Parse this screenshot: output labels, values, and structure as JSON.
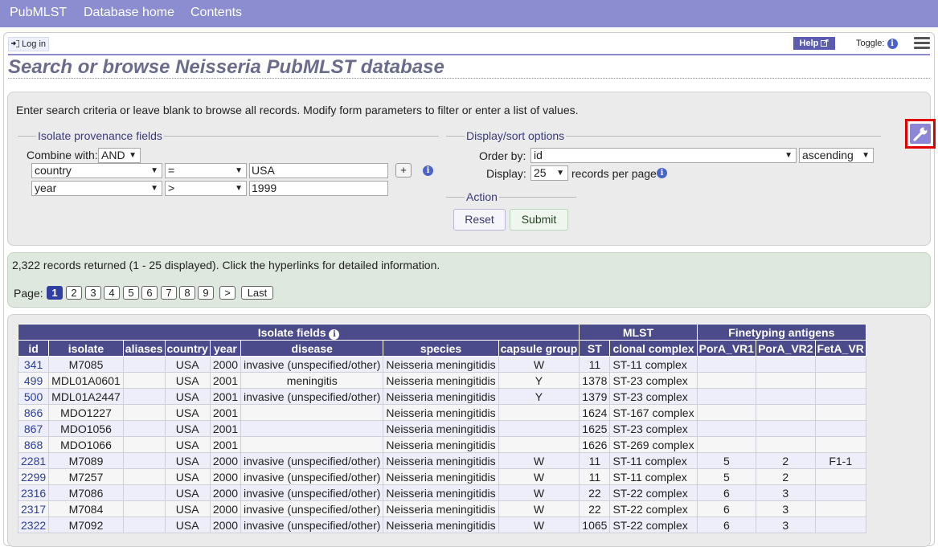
{
  "nav": {
    "items": [
      "PubMLST",
      "Database home",
      "Contents"
    ]
  },
  "header": {
    "login_label": "Log in",
    "help_label": "Help",
    "toggle_label": "Toggle:",
    "toggle_icon_text": "i"
  },
  "page_title": "Search or browse Neisseria PubMLST database",
  "search": {
    "intro": "Enter search criteria or leave blank to browse all records. Modify form parameters to filter or enter a list of values.",
    "provenance_legend": "Isolate provenance fields",
    "combine_label": "Combine with:",
    "combine_value": "AND",
    "rows": [
      {
        "field": "country",
        "operator": "=",
        "value": "USA"
      },
      {
        "field": "year",
        "operator": ">",
        "value": "1999"
      }
    ],
    "add_label": "+",
    "display_legend": "Display/sort options",
    "order_label": "Order by:",
    "order_value": "id",
    "direction_value": "ascending",
    "display_label": "Display:",
    "display_value": "25",
    "records_per_page": "records per page",
    "action_legend": "Action",
    "reset_label": "Reset",
    "submit_label": "Submit"
  },
  "results": {
    "summary": "2,322 records returned (1 - 25 displayed). Click the hyperlinks for detailed information.",
    "page_label": "Page:",
    "pages": [
      "1",
      "2",
      "3",
      "4",
      "5",
      "6",
      "7",
      "8",
      "9",
      ">",
      "Last"
    ],
    "current_page": "1"
  },
  "table": {
    "group_headers": [
      "Isolate fields",
      "MLST",
      "Finetyping antigens"
    ],
    "columns": [
      "id",
      "isolate",
      "aliases",
      "country",
      "year",
      "disease",
      "species",
      "capsule group",
      "ST",
      "clonal complex",
      "PorA_VR1",
      "PorA_VR2",
      "FetA_VR"
    ],
    "rows": [
      [
        "341",
        "M7085",
        "",
        "USA",
        "2000",
        "invasive (unspecified/other)",
        "Neisseria meningitidis",
        "W",
        "11",
        "ST-11 complex",
        "",
        "",
        ""
      ],
      [
        "499",
        "MDL01A0601",
        "",
        "USA",
        "2001",
        "meningitis",
        "Neisseria meningitidis",
        "Y",
        "1378",
        "ST-23 complex",
        "",
        "",
        ""
      ],
      [
        "500",
        "MDL01A2447",
        "",
        "USA",
        "2001",
        "invasive (unspecified/other)",
        "Neisseria meningitidis",
        "Y",
        "1379",
        "ST-23 complex",
        "",
        "",
        ""
      ],
      [
        "866",
        "MDO1227",
        "",
        "USA",
        "2001",
        "",
        "Neisseria meningitidis",
        "",
        "1624",
        "ST-167 complex",
        "",
        "",
        ""
      ],
      [
        "867",
        "MDO1056",
        "",
        "USA",
        "2001",
        "",
        "Neisseria meningitidis",
        "",
        "1625",
        "ST-23 complex",
        "",
        "",
        ""
      ],
      [
        "868",
        "MDO1066",
        "",
        "USA",
        "2001",
        "",
        "Neisseria meningitidis",
        "",
        "1626",
        "ST-269 complex",
        "",
        "",
        ""
      ],
      [
        "2281",
        "M7089",
        "",
        "USA",
        "2000",
        "invasive (unspecified/other)",
        "Neisseria meningitidis",
        "W",
        "11",
        "ST-11 complex",
        "5",
        "2",
        "F1-1"
      ],
      [
        "2299",
        "M7257",
        "",
        "USA",
        "2000",
        "invasive (unspecified/other)",
        "Neisseria meningitidis",
        "W",
        "11",
        "ST-11 complex",
        "5",
        "2",
        ""
      ],
      [
        "2316",
        "M7086",
        "",
        "USA",
        "2000",
        "invasive (unspecified/other)",
        "Neisseria meningitidis",
        "W",
        "22",
        "ST-22 complex",
        "6",
        "3",
        ""
      ],
      [
        "2317",
        "M7084",
        "",
        "USA",
        "2000",
        "invasive (unspecified/other)",
        "Neisseria meningitidis",
        "W",
        "22",
        "ST-22 complex",
        "6",
        "3",
        ""
      ],
      [
        "2322",
        "M7092",
        "",
        "USA",
        "2000",
        "invasive (unspecified/other)",
        "Neisseria meningitidis",
        "W",
        "1065",
        "ST-22 complex",
        "6",
        "3",
        ""
      ]
    ]
  }
}
